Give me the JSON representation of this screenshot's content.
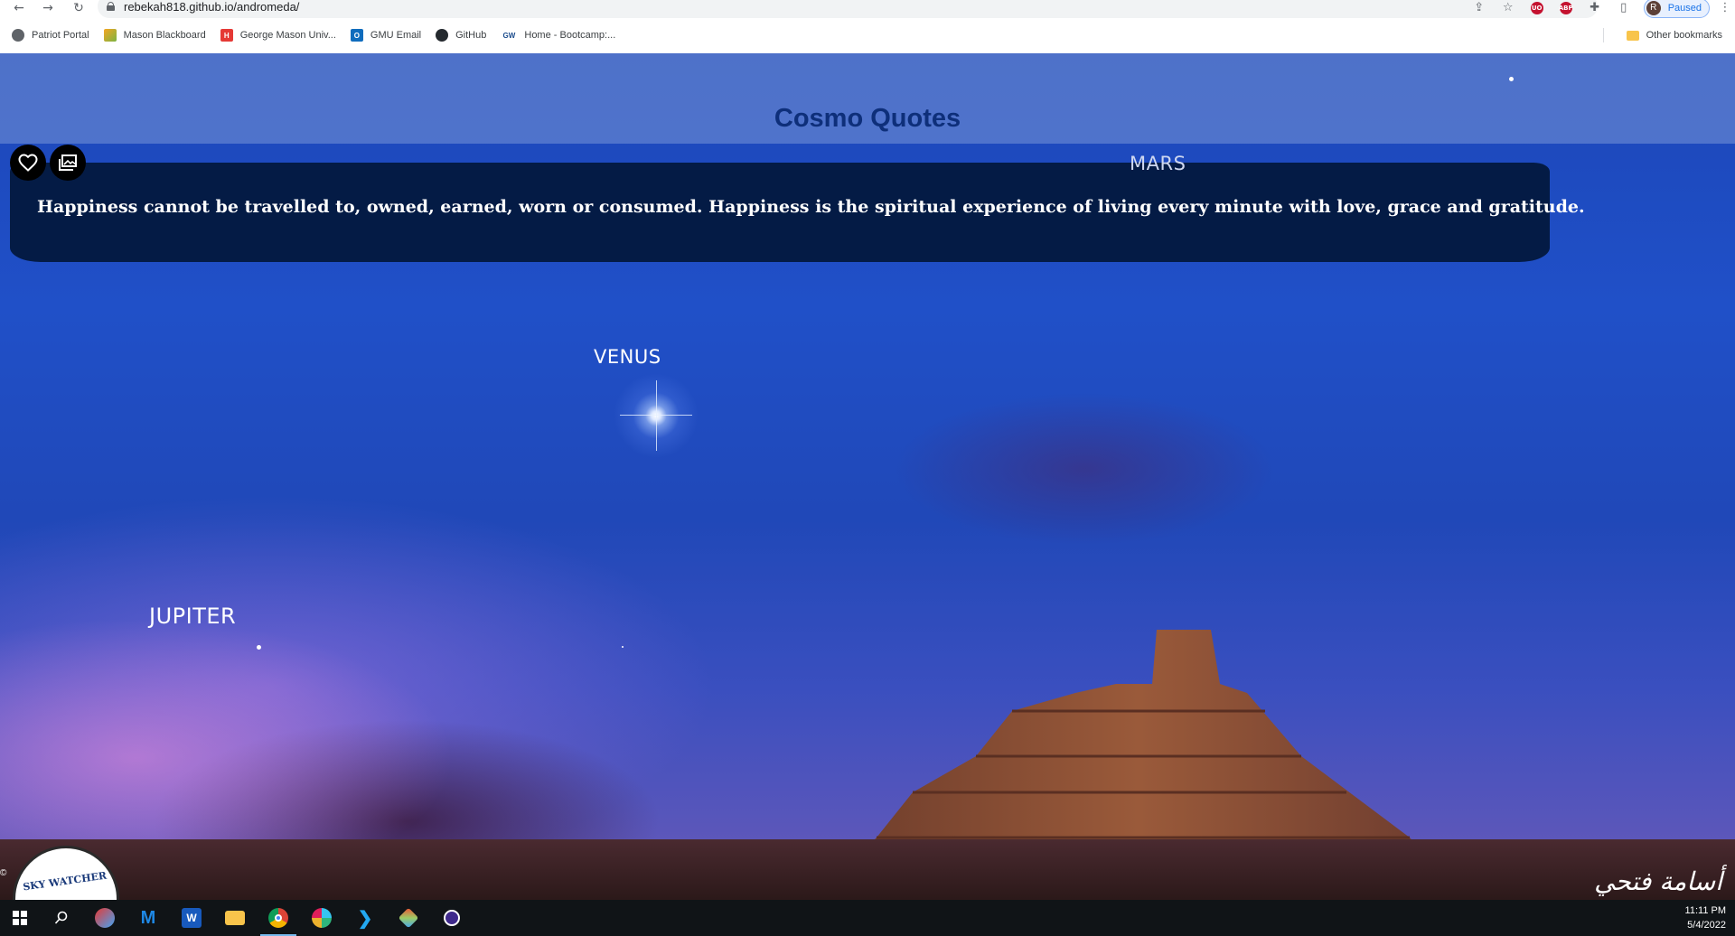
{
  "browser": {
    "url": "rebekah818.github.io/andromeda/",
    "profile_initial": "R",
    "profile_status": "Paused",
    "ext_ublock": "UO",
    "ext_abp": "ABP"
  },
  "bookmarks": {
    "items": [
      {
        "label": "Patriot Portal",
        "icon": "globe-icon",
        "color": "#5f6368",
        "glyph": ""
      },
      {
        "label": "Mason Blackboard",
        "icon": "blackboard-icon",
        "color": "#f5a623",
        "glyph": ""
      },
      {
        "label": "George Mason Univ...",
        "icon": "gmu-icon",
        "color": "#e53935",
        "glyph": "H"
      },
      {
        "label": "GMU Email",
        "icon": "outlook-icon",
        "color": "#0f6cbd",
        "glyph": "O"
      },
      {
        "label": "GitHub",
        "icon": "github-icon",
        "color": "#24292e",
        "glyph": ""
      },
      {
        "label": "Home - Bootcamp:...",
        "icon": "gw-icon",
        "color": "#ffffff",
        "glyph": "GW"
      }
    ],
    "other_label": "Other bookmarks"
  },
  "page": {
    "title": "Cosmo Quotes",
    "quote": "Happiness cannot be travelled to, owned, earned, worn or consumed. Happiness is the spiritual experience of living every minute with love, grace and gratitude.",
    "labels": {
      "mars": "MARS",
      "venus": "VENUS",
      "jupiter": "JUPITER"
    },
    "logo_text": "SKY WATCHER",
    "copyright": "©",
    "signature": "أسامة فتحي"
  },
  "taskbar": {
    "time": "11:11 PM",
    "date": "5/4/2022"
  },
  "colors": {
    "quote_bg": "#041b45",
    "title": "#0e2f7a",
    "sky": "#2050c8"
  }
}
